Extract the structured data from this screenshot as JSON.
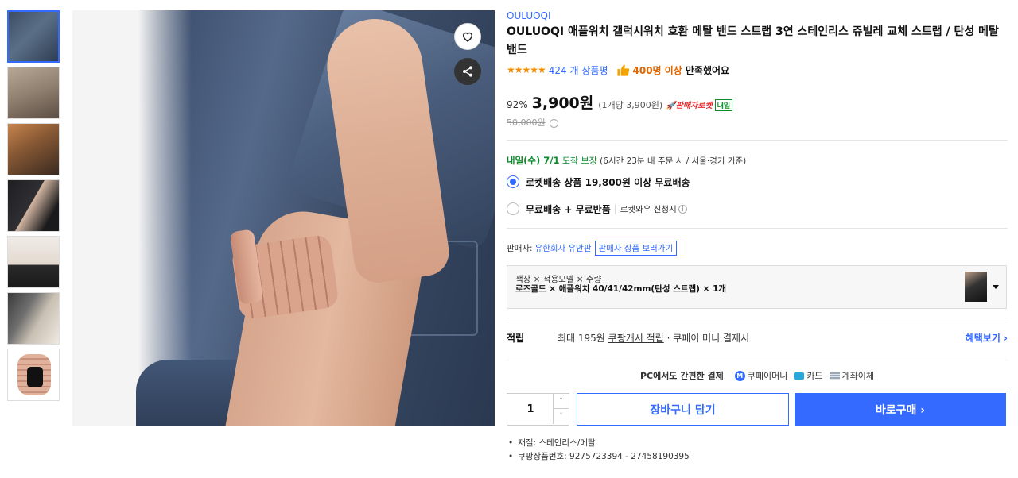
{
  "thumbnails": [
    {
      "name": "thumb-1",
      "active": true
    },
    {
      "name": "thumb-2"
    },
    {
      "name": "thumb-3"
    },
    {
      "name": "thumb-4"
    },
    {
      "name": "thumb-5"
    },
    {
      "name": "thumb-6"
    },
    {
      "name": "thumb-7"
    }
  ],
  "icons": {
    "wishlist": "heart-icon",
    "share": "share-icon",
    "thumbs_up": "thumbs-up-icon",
    "info": "info-icon",
    "dropdown": "chevron-down-icon"
  },
  "colors": {
    "accent": "#346aff",
    "star": "#f28c00",
    "satisfied": "#e06600",
    "rocket": "#e52528",
    "green": "#0a8a2a"
  },
  "product": {
    "brand": "OULUOQI",
    "title": "OULUOQI 애플워치 갤럭시워치 호환 메탈 밴드 스트랩 3연 스테인리스 쥬빌레 교체 스트랩 / 탄성 메탈 밴드",
    "rating_stars": "★★★★★",
    "review_count": "424 개 상품평",
    "satisfied_count": "400명 이상",
    "satisfied_rest": "만족했어요",
    "discount": "92%",
    "price": "3,900원",
    "unit_price": "(1개당 3,900원)",
    "rocket_label": "🚀판매자로켓",
    "tomorrow_badge": "내일",
    "original_price": "50,000원",
    "info_glyph": "i"
  },
  "delivery": {
    "arrival_bold": "내일(수) 7/1",
    "arrival_suffix": "도착 보장",
    "condition": "(6시간 23분 내 주문 시 / 서울·경기 기준)",
    "options": [
      {
        "label": "로켓배송 상품 19,800원 이상 무료배송",
        "selected": true,
        "sub": ""
      },
      {
        "label": "무료배송 + 무료반품",
        "selected": false,
        "sub": "로켓와우 신청시"
      }
    ]
  },
  "seller": {
    "label": "판매자:",
    "name": "유한회사 유안판",
    "link": "판매자 상품 보러가기"
  },
  "option_selector": {
    "header": "색상 × 적용모델 × 수량",
    "value": "로즈골드 × 애플워치 40/41/42mm(탄성 스트랩) × 1개"
  },
  "reward": {
    "label": "적립",
    "text_pre": "최대 195원",
    "text_link": "쿠팡캐시 적립",
    "text_post": "· 쿠페이 머니 결제시",
    "more": "혜택보기 ›"
  },
  "pc_pay": {
    "lead": "PC에서도 간편한 결제",
    "coupay": "쿠페이머니",
    "coupay_glyph": "M",
    "card": "카드",
    "bank": "계좌이체"
  },
  "purchase": {
    "quantity": "1",
    "qty_up": "˄",
    "qty_down": "˅",
    "cart_label": "장바구니 담기",
    "buy_label": "바로구매 ›"
  },
  "attributes": [
    "재질: 스테인리스/메탈",
    "쿠팡상품번호: 9275723394 - 27458190395"
  ]
}
